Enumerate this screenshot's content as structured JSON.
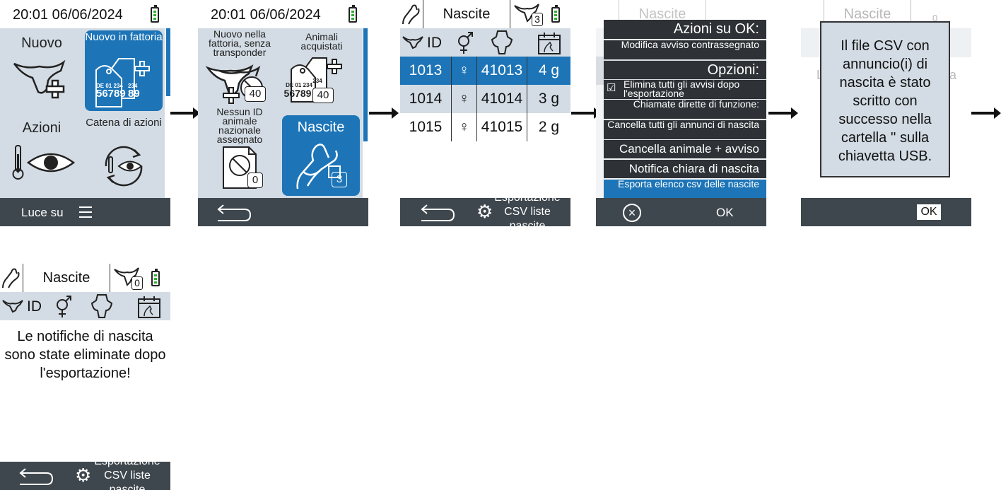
{
  "screen1": {
    "time": "20:01 06/06/2024",
    "tiles": [
      {
        "label": "Nuovo"
      },
      {
        "label": "Nuovo in fattoria",
        "tag_line1": "DE 01 234",
        "tag_line2": "56789",
        "tag_back": "234",
        "tag_back2": "89"
      },
      {
        "label": "Azioni"
      },
      {
        "label": "Catena di azioni"
      }
    ],
    "footer_label": "Luce su"
  },
  "screen2": {
    "time": "20:01 06/06/2024",
    "tiles": [
      {
        "label": "Nuovo nella fattoria, senza transponder",
        "badge": "40"
      },
      {
        "label": "Animali acquistati",
        "badge": "40",
        "tag_line1": "DE 01 234",
        "tag_line2": "56789",
        "tag_back": "234"
      },
      {
        "label": "Nessun ID animale nazionale assegnato",
        "badge": "0"
      },
      {
        "label": "Nascite",
        "badge": "3"
      }
    ]
  },
  "screen3": {
    "title": "Nascite",
    "header_badge": "3",
    "col_id": "ID",
    "rows": [
      {
        "id": "1013",
        "sex": "♀",
        "mother": "41013",
        "age": "4 g"
      },
      {
        "id": "1014",
        "sex": "♀",
        "mother": "41014",
        "age": "3 g"
      },
      {
        "id": "1015",
        "sex": "♀",
        "mother": "41015",
        "age": "2 g"
      }
    ],
    "footer_label": "Esportazione CSV liste nascite"
  },
  "screen4": {
    "bg_title": "Nascite",
    "header_actions": "Azioni su OK:",
    "item_modify": "Modifica avviso contrassegnato",
    "header_options": "Opzioni:",
    "item_delete_after": "Elimina tutti gli avvisi dopo l'esportazione",
    "checkbox_symbol": "☑",
    "item_direct": "Chiamate dirette di funzione:",
    "item_cancel_all": "Cancella tutti gli annunci di nascita",
    "item_cancel_animal": "Cancella animale + avviso",
    "item_notify": "Notifica chiara di nascita",
    "item_export": "Esporta elenco csv delle nascite",
    "footer_ok": "OK"
  },
  "screen5": {
    "bg_title": "Nascite",
    "bg_badge": "0",
    "bg_left_letter": "L",
    "bg_right_letter": "a",
    "dialog_text": "Il file CSV con annuncio(i) di nascita è stato scritto con successo nella cartella '' sulla chiavetta USB.",
    "footer_ok": "OK"
  },
  "screen6": {
    "title": "Nascite",
    "header_badge": "0",
    "col_id": "ID",
    "message": "Le notifiche di nascita sono state eliminate dopo l'esportazione!",
    "footer_label": "Esportazione CSV liste nascite"
  },
  "colors": {
    "accent": "#1d75b8",
    "footer": "#3f474e",
    "menu": "#2e3236",
    "tile_bg": "#d3dce4",
    "battery": "#2bb12b"
  }
}
